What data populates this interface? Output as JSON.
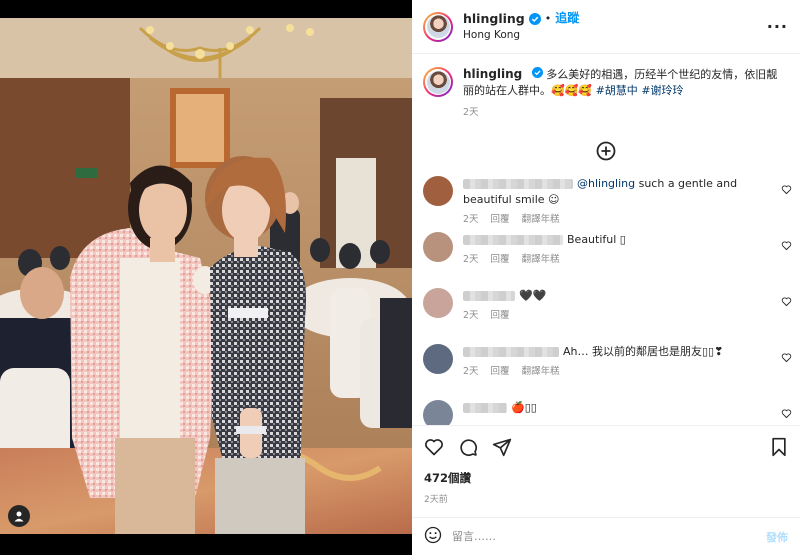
{
  "post": {
    "username": "hlingling",
    "follow_label": "追蹤",
    "location": "Hong Kong",
    "caption_text": "多么美好的相遇，历经半个世纪的友情，依旧靓丽的站在人群中。🥰🥰🥰 ",
    "hashtags": [
      "#胡慧中",
      "#谢玲玲"
    ],
    "caption_age": "2天",
    "likes": "472個讚",
    "posted_ago": "2天前"
  },
  "comments": [
    {
      "mention": "@hlingling",
      "text": " such a gentle and beautiful smile ☺",
      "age": "2天",
      "reply": "回覆",
      "translate": "翻譯年糕",
      "avatar_color": "#a0603f"
    },
    {
      "mention": "",
      "text": "Beautiful ▯",
      "age": "2天",
      "reply": "回覆",
      "translate": "翻譯年糕",
      "avatar_color": "#b8927d"
    },
    {
      "mention": "",
      "text": "🖤🖤",
      "age": "2天",
      "reply": "回覆",
      "translate": "",
      "avatar_color": "#c8a49a"
    },
    {
      "mention": "",
      "text": "Ah… 我以前的鄰居也是朋友▯▯❣",
      "age": "2天",
      "reply": "回覆",
      "translate": "翻譯年糕",
      "avatar_color": "#5e6a80"
    },
    {
      "mention": "",
      "text": "🍎▯▯",
      "age": "",
      "reply": "",
      "translate": "",
      "avatar_color": "#7a8598"
    }
  ],
  "comment_input": {
    "placeholder": "留言……",
    "post_label": "發佈"
  },
  "icons": {
    "verified": "verified-badge-icon",
    "more": "more-options-icon",
    "load_more": "plus-circle-icon",
    "like": "heart-icon",
    "comment": "comment-icon",
    "share": "paper-plane-icon",
    "save": "bookmark-icon",
    "emoji": "emoji-icon",
    "tag": "user-tag-icon"
  },
  "colors": {
    "link": "#0095f6",
    "hashtag": "#00376b",
    "meta": "#8e8e8e"
  }
}
